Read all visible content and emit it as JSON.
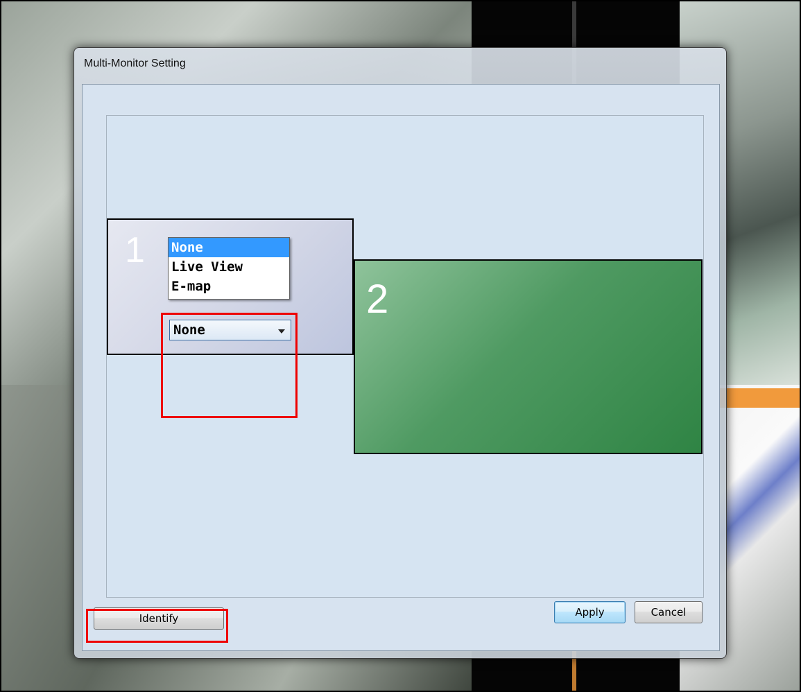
{
  "window": {
    "title": "Multi-Monitor Setting"
  },
  "monitors": [
    {
      "number": "1"
    },
    {
      "number": "2"
    }
  ],
  "display_select": {
    "selected": "None",
    "options": [
      "None",
      "Live View",
      "E-map"
    ],
    "highlighted_option": "None"
  },
  "buttons": {
    "identify": "Identify",
    "apply": "Apply",
    "cancel": "Cancel"
  },
  "colors": {
    "monitor_1_fill": "#d2d6e6",
    "monitor_2_fill": "#4f9a62",
    "highlight_box": "#ee0000",
    "selected_option": "#3399ff"
  },
  "icons": {
    "dropdown_arrow": "chevron-down-icon"
  }
}
